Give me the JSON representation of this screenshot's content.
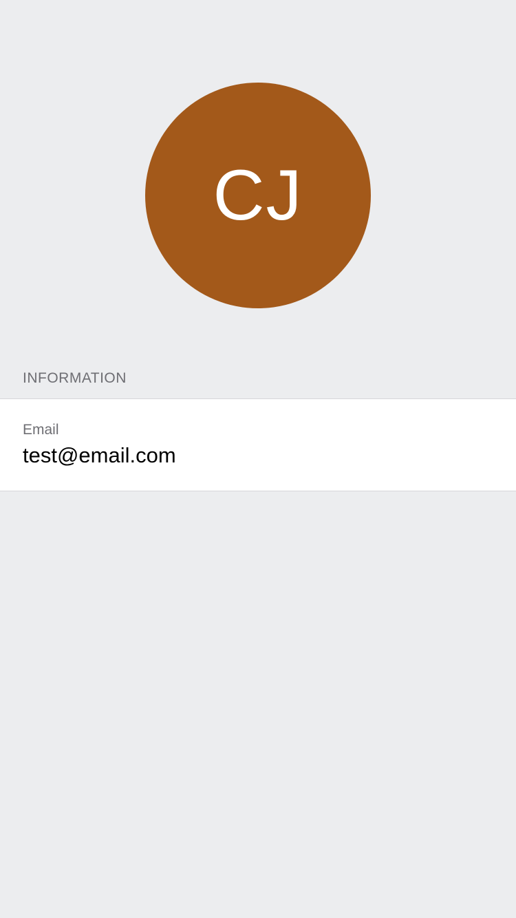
{
  "profile": {
    "initials": "CJ",
    "avatar_color": "#a3591a"
  },
  "information_section": {
    "title": "INFORMATION",
    "fields": [
      {
        "label": "Email",
        "value": "test@email.com"
      }
    ]
  },
  "colors": {
    "background": "#ecedef",
    "card": "#ffffff",
    "secondary_text": "#6e6e73"
  }
}
